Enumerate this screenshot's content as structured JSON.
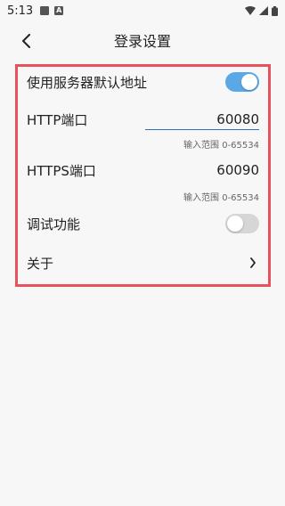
{
  "status_bar": {
    "time": "5:13",
    "icon_a": "A"
  },
  "header": {
    "title": "登录设置"
  },
  "settings": {
    "use_default_address_label": "使用服务器默认地址",
    "use_default_address_on": true,
    "http_port_label": "HTTP端口",
    "http_port_value": "60080",
    "http_port_hint": "输入范围 0-65534",
    "https_port_label": "HTTPS端口",
    "https_port_value": "60090",
    "https_port_hint": "输入范围 0-65534",
    "debug_label": "调试功能",
    "debug_on": false,
    "about_label": "关于"
  },
  "colors": {
    "accent": "#5aa9e6",
    "highlight_border": "#e8525c",
    "input_underline": "#2c6fb7"
  }
}
